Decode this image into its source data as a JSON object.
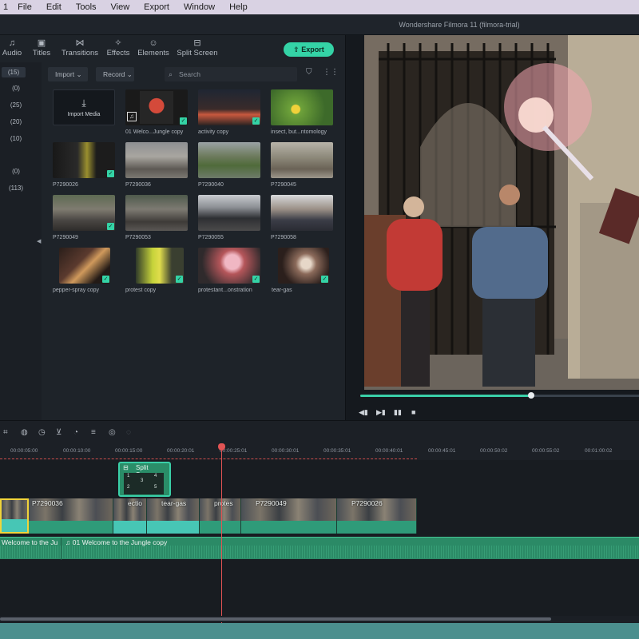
{
  "menubar": {
    "items": [
      "1",
      "File",
      "Edit",
      "Tools",
      "View",
      "Export",
      "Window",
      "Help"
    ]
  },
  "window": {
    "title": "Wondershare Filmora 11 (filmora-trial)"
  },
  "toolbar": {
    "tabs": [
      {
        "label": "Audio",
        "icon": "music-note-icon"
      },
      {
        "label": "Titles",
        "icon": "titles-icon"
      },
      {
        "label": "Transitions",
        "icon": "transitions-icon"
      },
      {
        "label": "Effects",
        "icon": "effects-sparkle-icon"
      },
      {
        "label": "Elements",
        "icon": "elements-icon"
      },
      {
        "label": "Split Screen",
        "icon": "split-screen-icon"
      }
    ],
    "export_label": "Export",
    "export_color": "#34d3a6"
  },
  "categories": [
    "(15)",
    "(0)",
    "(25)",
    "(20)",
    "(10)",
    "(0)",
    "(113)"
  ],
  "filters": {
    "import_label": "Import",
    "record_label": "Record",
    "search_placeholder": "Search"
  },
  "media": {
    "import_label": "Import Media",
    "items": [
      {
        "name": "01 Welco...Jungle copy"
      },
      {
        "name": "activity copy"
      },
      {
        "name": "insect, but...ntomology"
      },
      {
        "name": "P7290026"
      },
      {
        "name": "P7290036"
      },
      {
        "name": "P7290040"
      },
      {
        "name": "P7290045"
      },
      {
        "name": "P7290049"
      },
      {
        "name": "P7290053"
      },
      {
        "name": "P7290055"
      },
      {
        "name": "P7290058"
      },
      {
        "name": "pepper-spray copy"
      },
      {
        "name": "protest copy"
      },
      {
        "name": "protestant...onstration"
      },
      {
        "name": "tear-gas"
      }
    ]
  },
  "player": {
    "progress": 0.61
  },
  "timeline": {
    "ticks": [
      "00:00:05:00",
      "00:00:10:00",
      "00:00:15:00",
      "00:00:20:01",
      "00:00:25:01",
      "00:00:30:01",
      "00:00:35:01",
      "00:00:40:01",
      "00:00:45:01",
      "00:00:50:02",
      "00:00:55:02",
      "00:01:00:02"
    ],
    "split_label": "Split Screen",
    "split_cells": [
      "1",
      "3",
      "4",
      "2",
      "5"
    ],
    "clips": [
      "P7290036",
      "ectio",
      "tear-gas",
      "protes",
      "P7290049",
      "P7290026"
    ],
    "audio_label_1": "Welcome to the Ju",
    "audio_label_2": "01 Welcome to the Jungle copy"
  }
}
